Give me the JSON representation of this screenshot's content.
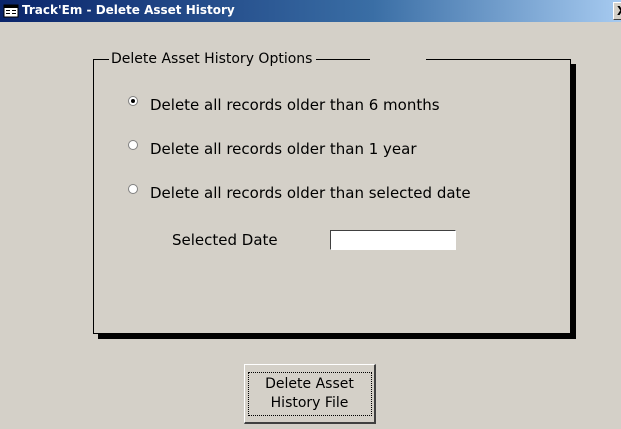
{
  "window": {
    "title": "Track'Em - Delete Asset History",
    "icon": "form-icon",
    "close_label": "X"
  },
  "options_group": {
    "legend": "Delete Asset History Options",
    "options": [
      {
        "label": "Delete all records older than 6 months",
        "checked": true
      },
      {
        "label": "Delete all records older than 1 year",
        "checked": false
      },
      {
        "label": "Delete all records older than selected date",
        "checked": false
      }
    ],
    "selected_date_label": "Selected Date",
    "selected_date_value": ""
  },
  "actions": {
    "delete_button_line1": "Delete Asset",
    "delete_button_line2": "History File"
  }
}
